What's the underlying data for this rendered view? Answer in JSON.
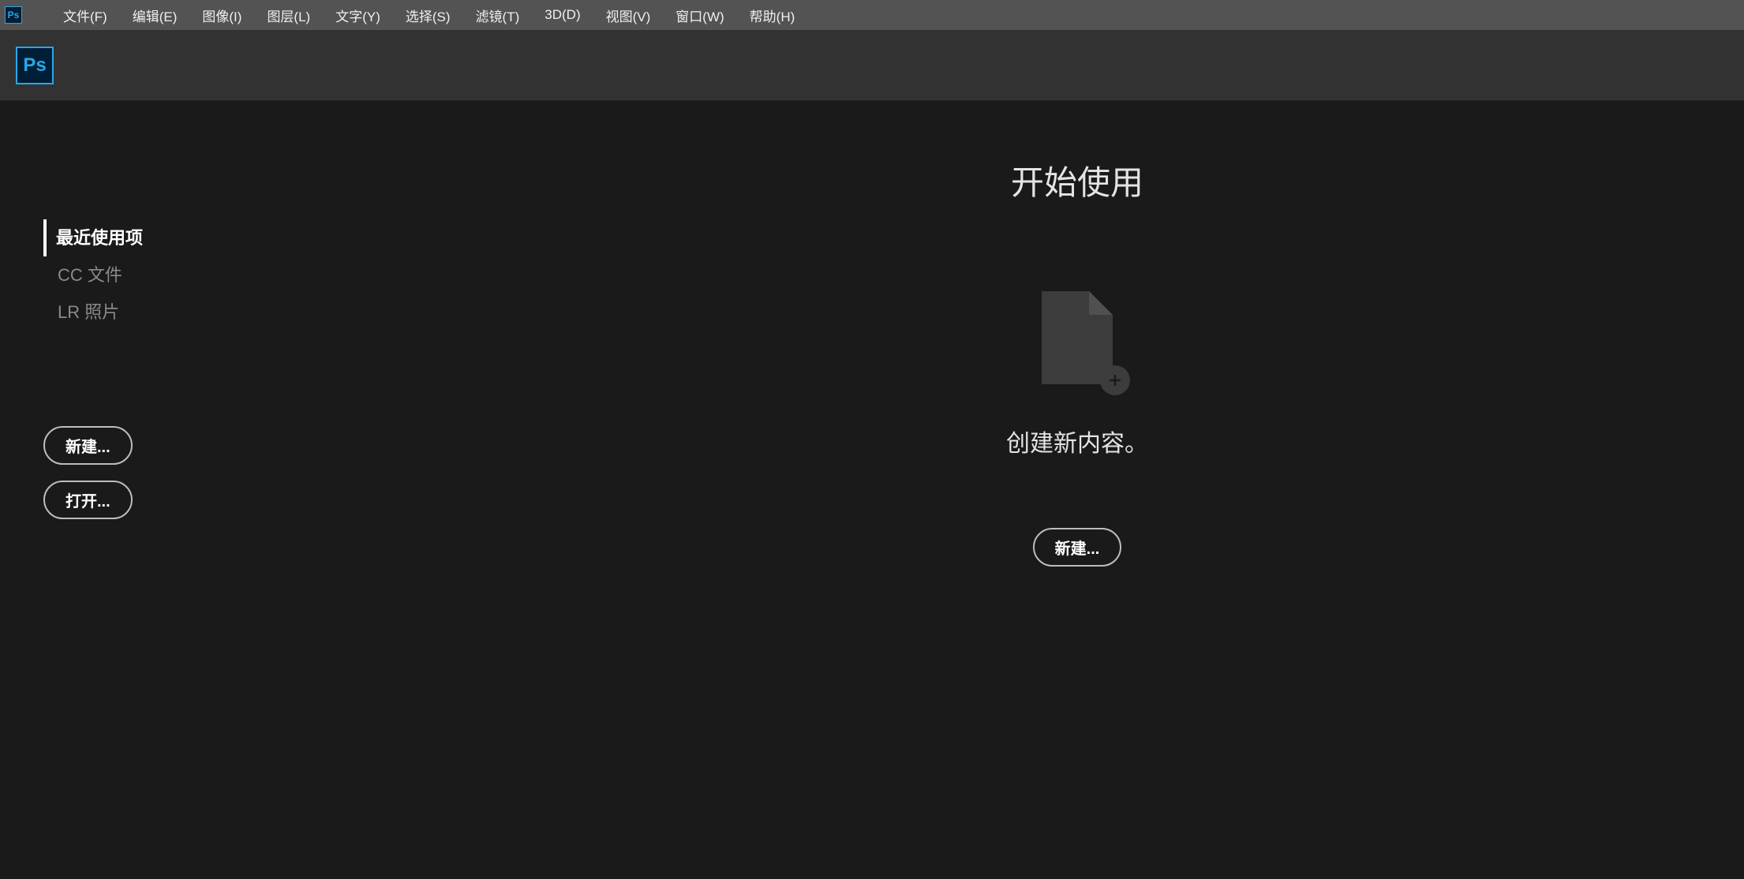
{
  "app_icon_text": "Ps",
  "menu": [
    "文件(F)",
    "编辑(E)",
    "图像(I)",
    "图层(L)",
    "文字(Y)",
    "选择(S)",
    "滤镜(T)",
    "3D(D)",
    "视图(V)",
    "窗口(W)",
    "帮助(H)"
  ],
  "side_nav": {
    "items": [
      {
        "label": "最近使用项",
        "active": true
      },
      {
        "label": "CC 文件",
        "active": false
      },
      {
        "label": "LR 照片",
        "active": false
      }
    ]
  },
  "left_actions": {
    "new": "新建...",
    "open": "打开..."
  },
  "center": {
    "headline": "开始使用",
    "subline": "创建新内容。",
    "new": "新建..."
  }
}
